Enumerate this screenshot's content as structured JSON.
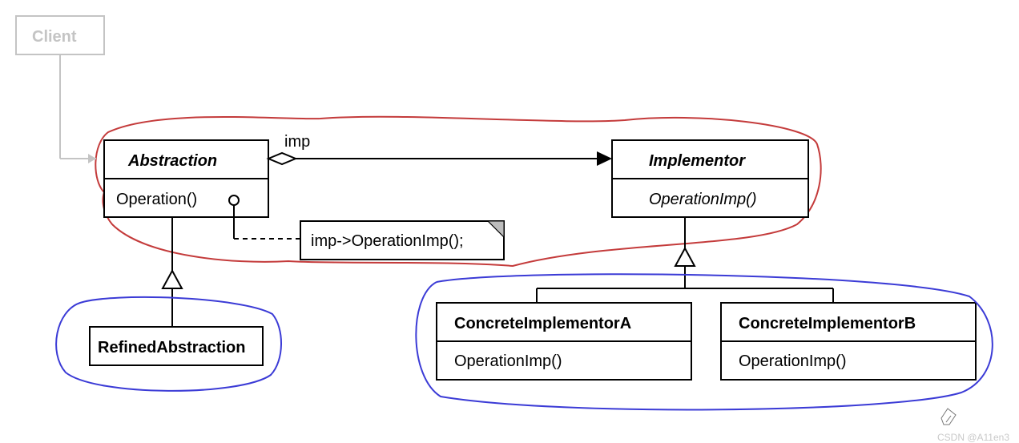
{
  "client": {
    "title": "Client"
  },
  "abstraction": {
    "title": "Abstraction",
    "method": "Operation()"
  },
  "implementor": {
    "title": "Implementor",
    "method": "OperationImp()"
  },
  "refined": {
    "title": "RefinedAbstraction"
  },
  "concreteA": {
    "title": "ConcreteImplementorA",
    "method": "OperationImp()"
  },
  "concreteB": {
    "title": "ConcreteImplementorB",
    "method": "OperationImp()"
  },
  "assoc": {
    "label": "imp"
  },
  "note": {
    "text": "imp->OperationImp();"
  },
  "watermark": "CSDN @A11en3",
  "colors": {
    "red": "#c43b3b",
    "blue": "#3b3bd6",
    "faded": "#c4c4c4"
  }
}
